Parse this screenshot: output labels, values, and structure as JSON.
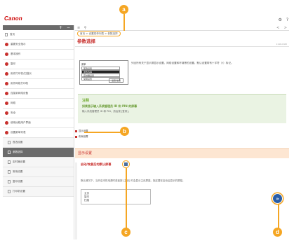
{
  "header": {
    "logo": "Canon",
    "icons": [
      "gear-icon",
      "help-icon"
    ]
  },
  "sidebar": {
    "toolbar": [
      "plus-icon",
      "minus-icon"
    ],
    "items": [
      {
        "label": "首页",
        "type": "doc"
      },
      {
        "label": "重要安全指示",
        "type": "dot"
      },
      {
        "label": "基本操作",
        "type": "dot"
      },
      {
        "label": "复印",
        "type": "dot"
      },
      {
        "label": "用作打印机/扫描仪",
        "type": "dot"
      },
      {
        "label": "用作网络打印机",
        "type": "dot"
      },
      {
        "label": "连接到网络设备",
        "type": "dot"
      },
      {
        "label": "网络",
        "type": "dot"
      },
      {
        "label": "安全",
        "type": "dot"
      },
      {
        "label": "使用远程用户界面",
        "type": "dot"
      },
      {
        "label": "设置菜单列表",
        "type": "dot"
      },
      {
        "label": "首选设置",
        "type": "doc",
        "sub": true
      },
      {
        "label": "参数选择",
        "type": "doc",
        "sub": true,
        "active": true
      },
      {
        "label": "定时器设置",
        "type": "doc",
        "sub": true
      },
      {
        "label": "常用设置",
        "type": "doc",
        "sub": true
      },
      {
        "label": "复印设置",
        "type": "doc",
        "sub": true
      },
      {
        "label": "打印机设置",
        "type": "doc",
        "sub": true
      }
    ]
  },
  "toolbar": {
    "menu_icon": "≡",
    "search_icon": "search-icon",
    "prev": "<",
    "next": ">"
  },
  "breadcrumb": "首页 > 设置菜单列表 > 参数选择",
  "page": {
    "title": "参数选择",
    "doc_id": "1116-01W",
    "intro": "列出所有关于显示屏显示设置、网络设置和环境等的设置。默认设置带有十字符（†）标记。",
    "screen": {
      "title": "菜单",
      "rows": [
        "首选设置",
        "参数选择",
        "定时器设置",
        "常用设置"
      ],
      "selected": 1,
      "button": "设置/注册"
    },
    "note": {
      "title": "注释",
      "heading": "如果显示输入系统管理员 ID 和 PIN 的屏幕",
      "body": "输入系统管理员 ID 和 PIN，然后按 [登录]。"
    },
    "links": [
      "显示设置",
      "布局设置"
    ],
    "section": "显示设置",
    "sub_heading": "启动/恢复后的默认屏幕",
    "sub_body": "默认情况下，当开启本机电源时或者按 [主页] 时会显示主页屏幕。指定要在启动后显示的屏幕。",
    "options": [
      "主页",
      "复印",
      "扫描"
    ]
  },
  "callouts": [
    "a",
    "b",
    "c",
    "d"
  ],
  "accent": "#f5a623",
  "brand": "#c8302d"
}
